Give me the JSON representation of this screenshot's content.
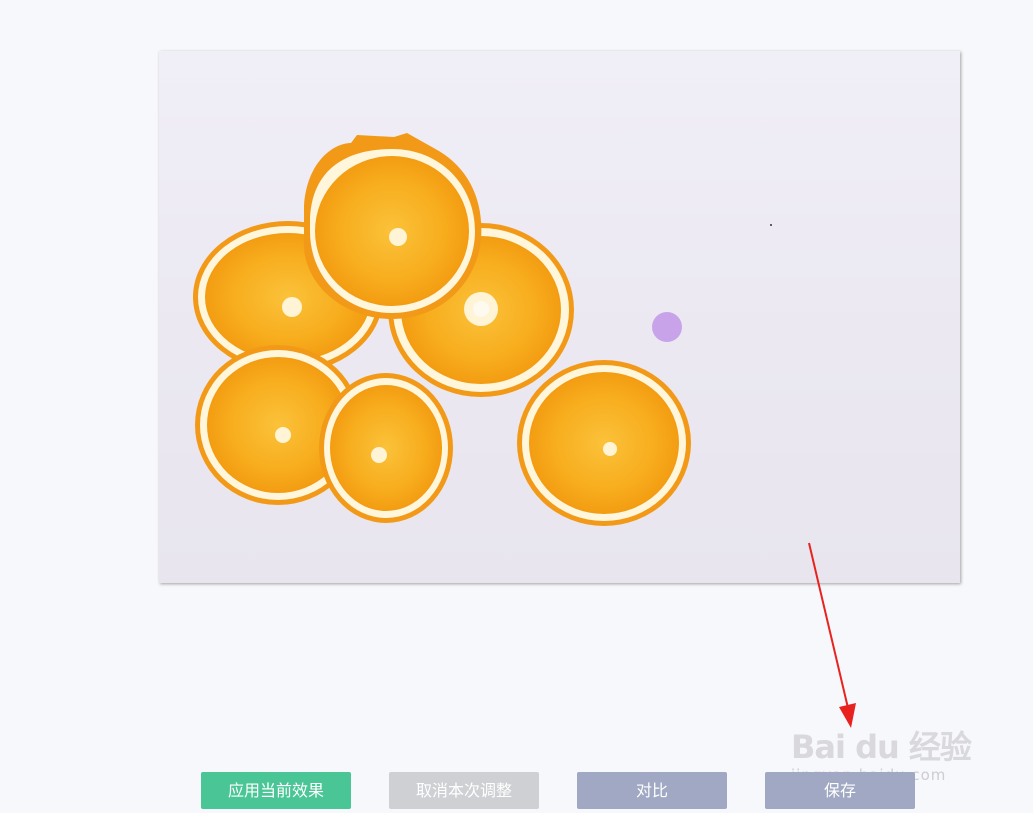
{
  "toolbar": {
    "apply_label": "应用当前效果",
    "cancel_label": "取消本次调整",
    "compare_label": "对比",
    "save_label": "保存"
  },
  "watermark": {
    "logo_text": "Bai du 经验",
    "url_text": "jingyan.baidu.com"
  },
  "colors": {
    "apply": "#49c596",
    "cancel": "#cfd0d3",
    "compare": "#a0a8c3",
    "save": "#a0a8c3",
    "annotation_arrow": "#e8231f",
    "cursor_dot": "#c9a3ea"
  },
  "icons": {
    "annotation": "red-arrow-icon",
    "cursor": "cursor-dot-icon"
  }
}
